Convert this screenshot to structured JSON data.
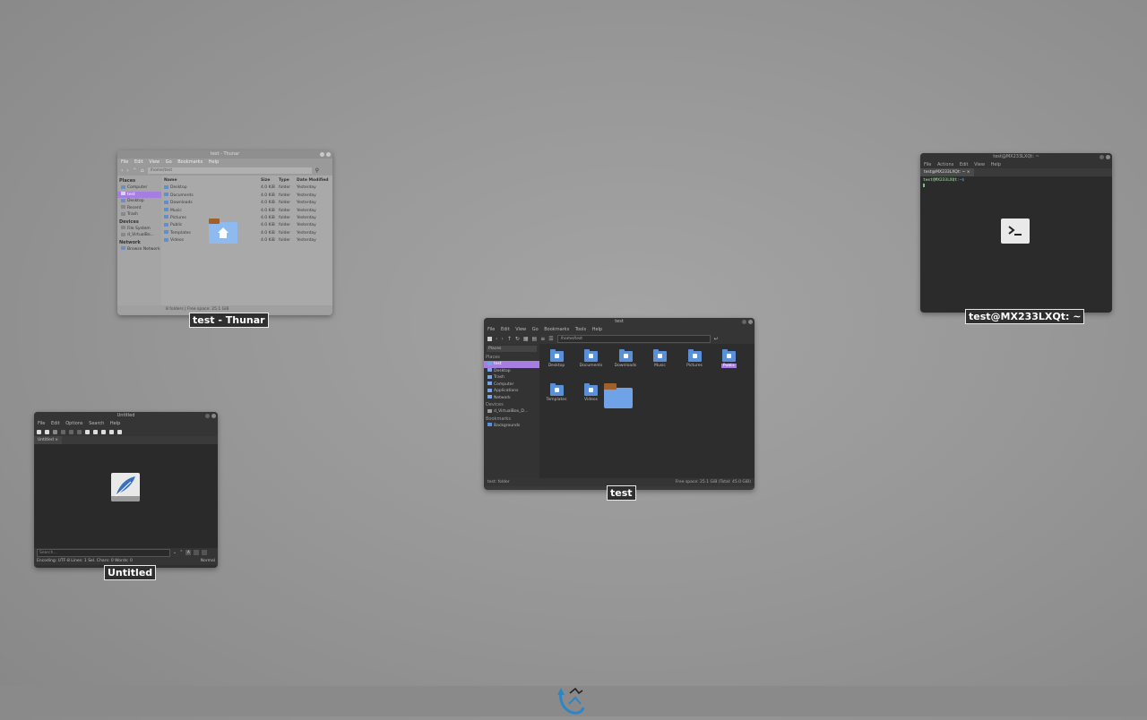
{
  "captions": {
    "thunar_light": "test - Thunar",
    "terminal": "test@MX233LXQt: ~",
    "thunar_dark": "test",
    "editor": "Untitled"
  },
  "thunar_light": {
    "title": "test - Thunar",
    "menu": [
      "File",
      "Edit",
      "View",
      "Go",
      "Bookmarks",
      "Help"
    ],
    "path": "/home/test",
    "sidebar": {
      "places_heading": "Places",
      "places": [
        "Computer",
        "test",
        "Desktop",
        "Recent",
        "Trash"
      ],
      "devices_heading": "Devices",
      "devices": [
        "File System",
        "d_VirtualBo..."
      ],
      "network_heading": "Network",
      "network": [
        "Browse Network"
      ]
    },
    "columns": [
      "Name",
      "Size",
      "Type",
      "Date Modified"
    ],
    "rows": [
      {
        "name": "Desktop",
        "size": "4.0 KiB",
        "type": "folder",
        "date": "Yesterday"
      },
      {
        "name": "Documents",
        "size": "4.0 KiB",
        "type": "folder",
        "date": "Yesterday"
      },
      {
        "name": "Downloads",
        "size": "4.0 KiB",
        "type": "folder",
        "date": "Yesterday"
      },
      {
        "name": "Music",
        "size": "4.0 KiB",
        "type": "folder",
        "date": "Yesterday"
      },
      {
        "name": "Pictures",
        "size": "4.0 KiB",
        "type": "folder",
        "date": "Yesterday"
      },
      {
        "name": "Public",
        "size": "4.0 KiB",
        "type": "folder",
        "date": "Yesterday"
      },
      {
        "name": "Templates",
        "size": "4.0 KiB",
        "type": "folder",
        "date": "Yesterday"
      },
      {
        "name": "Videos",
        "size": "4.0 KiB",
        "type": "folder",
        "date": "Yesterday"
      }
    ],
    "status": "8 folders | Free space: 25.1 GiB"
  },
  "terminal": {
    "title": "test@MX233LXQt: ~",
    "menu": [
      "File",
      "Actions",
      "Edit",
      "View",
      "Help"
    ],
    "tab": "test@MX233LXQt: ~",
    "prompt_user": "test@MX233LXQt",
    "prompt_rest": ":~$"
  },
  "thunar_dark": {
    "title": "test",
    "menu": [
      "File",
      "Edit",
      "View",
      "Go",
      "Bookmarks",
      "Tools",
      "Help"
    ],
    "path": "/home/test",
    "sidebar_combo": "Places",
    "places_heading": "Places",
    "places": [
      "test",
      "Desktop",
      "Trash",
      "Computer",
      "Applications",
      "Network"
    ],
    "devices_heading": "Devices",
    "devices": [
      "d_VirtualBox_D..."
    ],
    "bookmarks_heading": "Bookmarks",
    "bookmarks": [
      "Backgrounds"
    ],
    "items": [
      "Desktop",
      "Documents",
      "Downloads",
      "Music",
      "Pictures",
      "Public",
      "Templates",
      "Videos"
    ],
    "status_left": "test: folder",
    "status_right": "Free space: 25.1 GiB (Total: 45.0 GiB)"
  },
  "editor": {
    "title": "Untitled",
    "menu": [
      "File",
      "Edit",
      "Options",
      "Search",
      "Help"
    ],
    "tab": "Untitled",
    "search_placeholder": "Search...",
    "status": "Encoding: UTF-8   Lines: 1   Sel. Chars: 0   Words: 0",
    "status_right": "Normal"
  },
  "colors": {
    "accent_purple": "#a67de0",
    "folder_blue": "#5b8fd6",
    "terminal_bg": "#2b2b2b",
    "dark_window": "#3a3a3a"
  }
}
